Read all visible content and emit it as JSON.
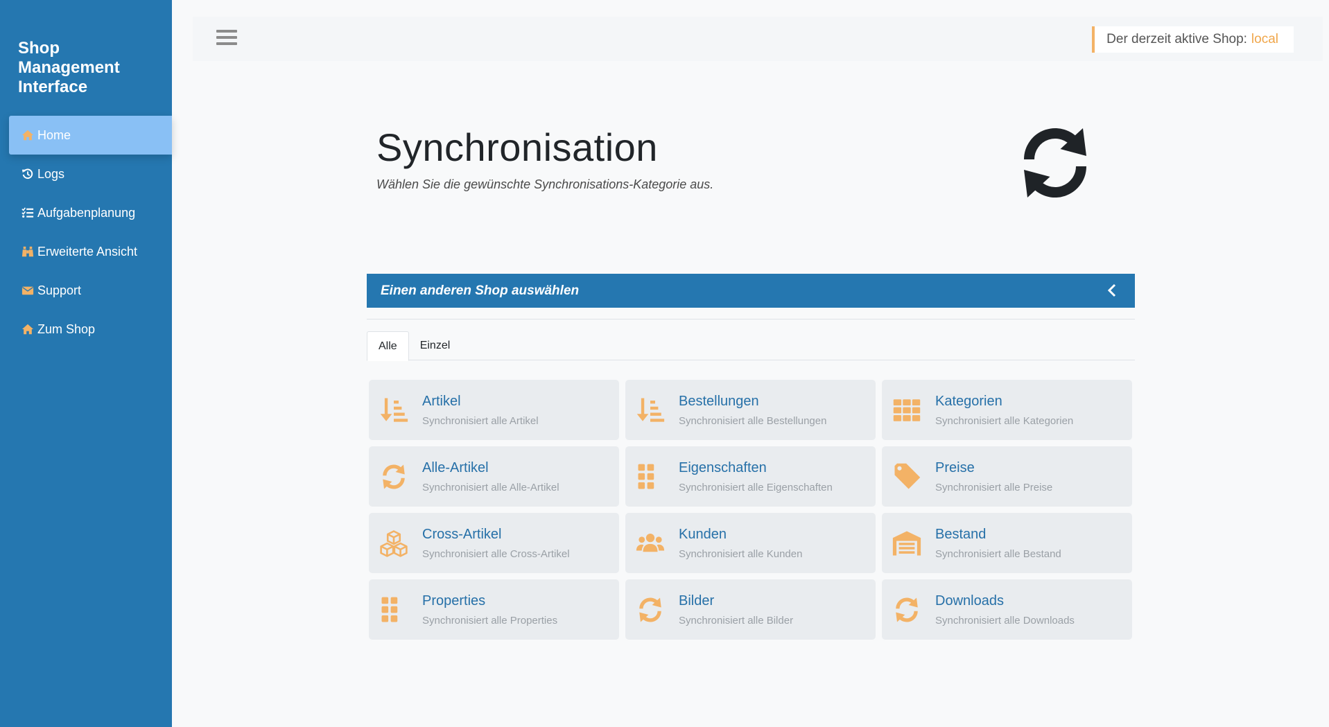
{
  "brand": "Shop Management Interface",
  "sidebar": {
    "items": [
      {
        "label": "Home",
        "icon": "home-icon"
      },
      {
        "label": "Logs",
        "icon": "history-icon"
      },
      {
        "label": "Aufgabenplanung",
        "icon": "tasks-icon"
      },
      {
        "label": "Erweiterte Ansicht",
        "icon": "binoculars-icon"
      },
      {
        "label": "Support",
        "icon": "envelope-icon"
      },
      {
        "label": "Zum Shop",
        "icon": "home-icon"
      }
    ]
  },
  "topbar": {
    "active_shop_label": "Der derzeit aktive Shop:",
    "active_shop_name": "local"
  },
  "page": {
    "title": "Synchronisation",
    "subtitle": "Wählen Sie die gewünschte Synchronisations-Kategorie aus."
  },
  "shop_select": {
    "label": "Einen anderen Shop auswählen"
  },
  "tabs": [
    {
      "label": "Alle"
    },
    {
      "label": "Einzel"
    }
  ],
  "cards": [
    {
      "title": "Artikel",
      "desc": "Synchronisiert alle Artikel",
      "icon": "sort-amount-down-icon"
    },
    {
      "title": "Bestellungen",
      "desc": "Synchronisiert alle Bestellungen",
      "icon": "sort-amount-down-icon"
    },
    {
      "title": "Kategorien",
      "desc": "Synchronisiert alle Kategorien",
      "icon": "th-grid-icon"
    },
    {
      "title": "Alle-Artikel",
      "desc": "Synchronisiert alle Alle-Artikel",
      "icon": "sync-icon"
    },
    {
      "title": "Eigenschaften",
      "desc": "Synchronisiert alle Eigenschaften",
      "icon": "th-large-icon"
    },
    {
      "title": "Preise",
      "desc": "Synchronisiert alle Preise",
      "icon": "tag-icon"
    },
    {
      "title": "Cross-Artikel",
      "desc": "Synchronisiert alle Cross-Artikel",
      "icon": "cubes-icon"
    },
    {
      "title": "Kunden",
      "desc": "Synchronisiert alle Kunden",
      "icon": "users-icon"
    },
    {
      "title": "Bestand",
      "desc": "Synchronisiert alle Bestand",
      "icon": "warehouse-icon"
    },
    {
      "title": "Properties",
      "desc": "Synchronisiert alle Properties",
      "icon": "th-large-icon"
    },
    {
      "title": "Bilder",
      "desc": "Synchronisiert alle Bilder",
      "icon": "sync-icon"
    },
    {
      "title": "Downloads",
      "desc": "Synchronisiert alle Downloads",
      "icon": "sync-icon"
    }
  ],
  "colors": {
    "primary": "#2577b0",
    "accent": "#f3b266",
    "card_bg": "#e9ecef",
    "card_title": "#2670a8"
  }
}
